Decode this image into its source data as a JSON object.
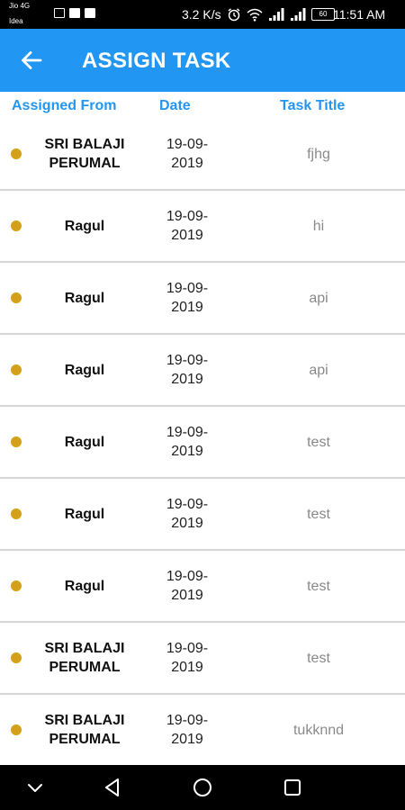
{
  "status_bar": {
    "carrier_line1": "Jio 4G",
    "carrier_line2": "Idea",
    "net_speed": "3.2 K/s",
    "battery": "60",
    "time": "11:51 AM"
  },
  "app_bar": {
    "title": "ASSIGN TASK",
    "accent_color": "#2196f3"
  },
  "table": {
    "headers": {
      "assigned_from": "Assigned From",
      "date": "Date",
      "task_title": "Task Title"
    },
    "status_dot_color": "#d4a017",
    "rows": [
      {
        "assigned_from": "SRI BALAJI PERUMAL",
        "date": "19-09-2019",
        "task_title": "fjhg"
      },
      {
        "assigned_from": "Ragul",
        "date": "19-09-2019",
        "task_title": "hi"
      },
      {
        "assigned_from": "Ragul",
        "date": "19-09-2019",
        "task_title": "api"
      },
      {
        "assigned_from": "Ragul",
        "date": "19-09-2019",
        "task_title": "api"
      },
      {
        "assigned_from": "Ragul",
        "date": "19-09-2019",
        "task_title": "test"
      },
      {
        "assigned_from": "Ragul",
        "date": "19-09-2019",
        "task_title": "test"
      },
      {
        "assigned_from": "Ragul",
        "date": "19-09-2019",
        "task_title": "test"
      },
      {
        "assigned_from": "SRI BALAJI PERUMAL",
        "date": "19-09-2019",
        "task_title": "test"
      },
      {
        "assigned_from": "SRI BALAJI PERUMAL",
        "date": "19-09-2019",
        "task_title": "tukknnd"
      }
    ]
  },
  "icons": {
    "back": "arrow-left-icon",
    "nav_collapse": "chevron-down-icon",
    "nav_back": "triangle-back-icon",
    "nav_home": "circle-home-icon",
    "nav_recents": "square-recents-icon"
  }
}
